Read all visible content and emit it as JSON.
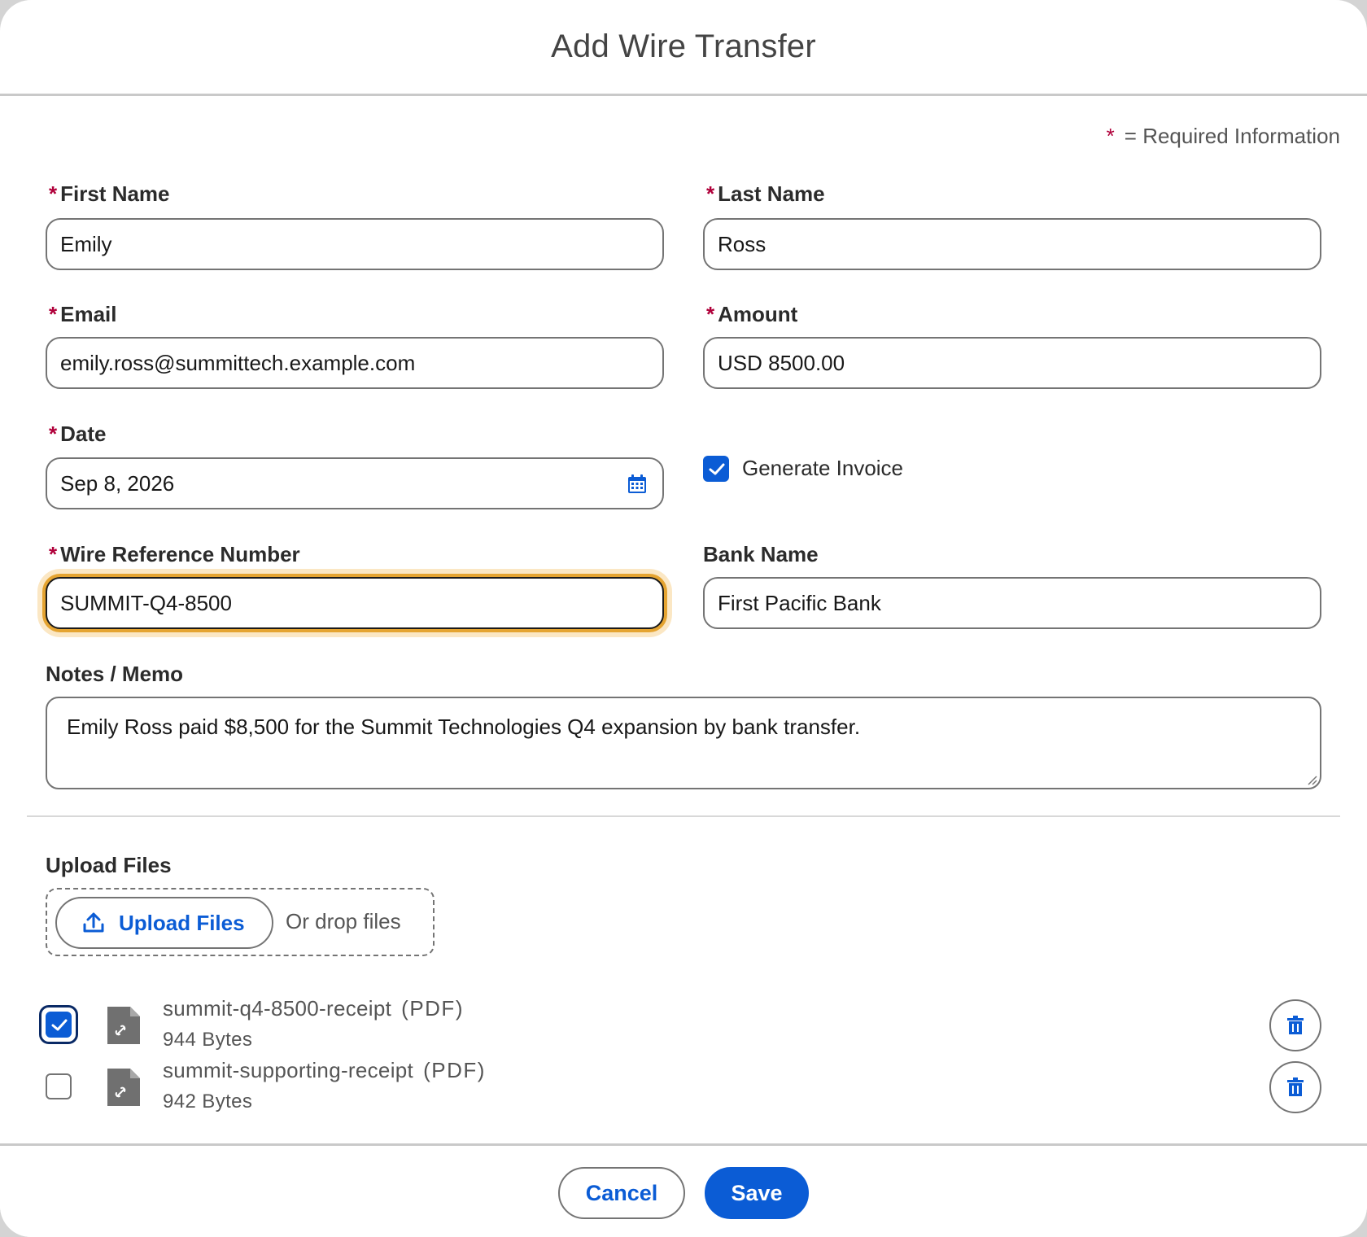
{
  "modal": {
    "title": "Add Wire Transfer"
  },
  "required_note": {
    "star": "*",
    "text": "= Required Information"
  },
  "fields": {
    "first_name": {
      "label": "First Name",
      "value": "Emily",
      "required": true
    },
    "last_name": {
      "label": "Last Name",
      "value": "Ross",
      "required": true
    },
    "email": {
      "label": "Email",
      "value": "emily.ross@summittech.example.com",
      "required": true
    },
    "amount": {
      "label": "Amount",
      "value": "USD 8500.00",
      "required": true
    },
    "date": {
      "label": "Date",
      "value": "Sep 8, 2026",
      "required": true
    },
    "generate_invoice": {
      "label": "Generate Invoice",
      "checked": true
    },
    "wire_reference": {
      "label": "Wire Reference Number",
      "value": "SUMMIT-Q4-8500",
      "required": true
    },
    "bank_name": {
      "label": "Bank Name",
      "value": "First Pacific Bank"
    },
    "notes": {
      "label": "Notes / Memo",
      "value": "Emily Ross paid $8,500 for the Summit Technologies Q4 expansion by bank transfer."
    }
  },
  "required_star": "*",
  "upload": {
    "label": "Upload Files",
    "button_label": "Upload Files",
    "drop_text": "Or drop files"
  },
  "files": [
    {
      "name": "summit-q4-8500-receipt",
      "type": "(PDF)",
      "size": "944 Bytes",
      "selected": true
    },
    {
      "name": "summit-supporting-receipt",
      "type": "(PDF)",
      "size": "942 Bytes",
      "selected": false
    }
  ],
  "footer": {
    "cancel_label": "Cancel",
    "save_label": "Save"
  },
  "colors": {
    "brand": "#0b5cd5",
    "required": "#b0003a",
    "focus": "#e5a431"
  }
}
